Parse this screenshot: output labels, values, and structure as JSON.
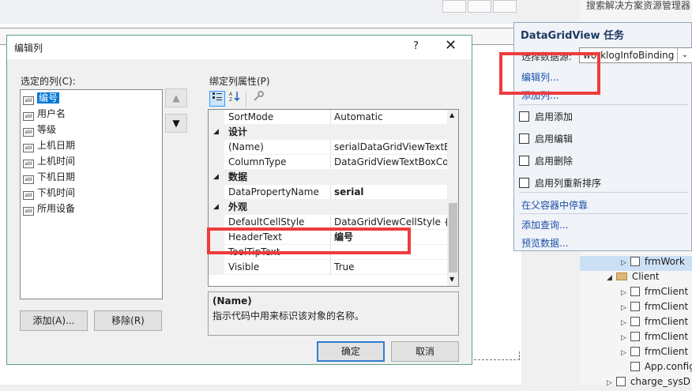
{
  "solution_explorer": {
    "header": "搜索解决方案资源管理器",
    "tree": [
      {
        "label": "frmWork",
        "kind": "file",
        "expander": "▷"
      },
      {
        "label": "Client",
        "kind": "folder",
        "expander": "◢"
      },
      {
        "label": "frmClient",
        "kind": "file",
        "expander": "▷"
      },
      {
        "label": "frmClient",
        "kind": "file",
        "expander": "▷"
      },
      {
        "label": "frmClient",
        "kind": "file",
        "expander": "▷"
      },
      {
        "label": "frmClient",
        "kind": "file",
        "expander": "▷"
      },
      {
        "label": "frmClient",
        "kind": "file",
        "expander": "▷"
      },
      {
        "label": "App.config",
        "kind": "file",
        "expander": ""
      },
      {
        "label": "charge_sysD",
        "kind": "file",
        "expander": "▷"
      }
    ]
  },
  "smart_tag": {
    "title": "DataGridView 任务",
    "datasource_label": "选择数据源:",
    "datasource_value": "worklogInfoBinding",
    "edit_columns": "编辑列...",
    "add_column": "添加列...",
    "checkboxes": [
      "启用添加",
      "启用编辑",
      "启用删除",
      "启用列重新排序"
    ],
    "dock": "在父容器中停靠",
    "add_query": "添加查询...",
    "preview_data": "预览数据..."
  },
  "dialog": {
    "title": "编辑列",
    "help": "?",
    "close": "✕",
    "selected_columns_label": "选定的列(C):",
    "columns": [
      "编号",
      "用户名",
      "等级",
      "上机日期",
      "上机时间",
      "下机日期",
      "下机时间",
      "所用设备"
    ],
    "selected_index": 0,
    "move_up": "▲",
    "move_down": "▼",
    "add_button": "添加(A)...",
    "remove_button": "移除(R)",
    "bound_props_label": "绑定列属性(P)",
    "properties": [
      {
        "type": "prop",
        "name": "SortMode",
        "value": "Automatic",
        "bold": false
      },
      {
        "type": "cat",
        "name": "设计"
      },
      {
        "type": "prop",
        "name": "(Name)",
        "value": "serialDataGridViewTextBoxColumn",
        "bold": false
      },
      {
        "type": "prop",
        "name": "ColumnType",
        "value": "DataGridViewTextBoxColumn",
        "bold": false
      },
      {
        "type": "cat",
        "name": "数据"
      },
      {
        "type": "prop",
        "name": "DataPropertyName",
        "value": "serial",
        "bold": true
      },
      {
        "type": "cat",
        "name": "外观"
      },
      {
        "type": "prop",
        "name": "DefaultCellStyle",
        "value": "DataGridViewCellStyle { }",
        "bold": false
      },
      {
        "type": "prop",
        "name": "HeaderText",
        "value": "编号",
        "bold": true
      },
      {
        "type": "prop",
        "name": "ToolTipText",
        "value": "",
        "bold": false
      },
      {
        "type": "prop",
        "name": "Visible",
        "value": "True",
        "bold": false
      }
    ],
    "description_title": "(Name)",
    "description_text": "指示代码中用来标识该对象的名称。",
    "ok": "确定",
    "cancel": "取消"
  },
  "colors": {
    "highlight_red": "#ef3b3b",
    "selection_blue": "#0078d7",
    "link_blue": "#1a4fa8"
  }
}
